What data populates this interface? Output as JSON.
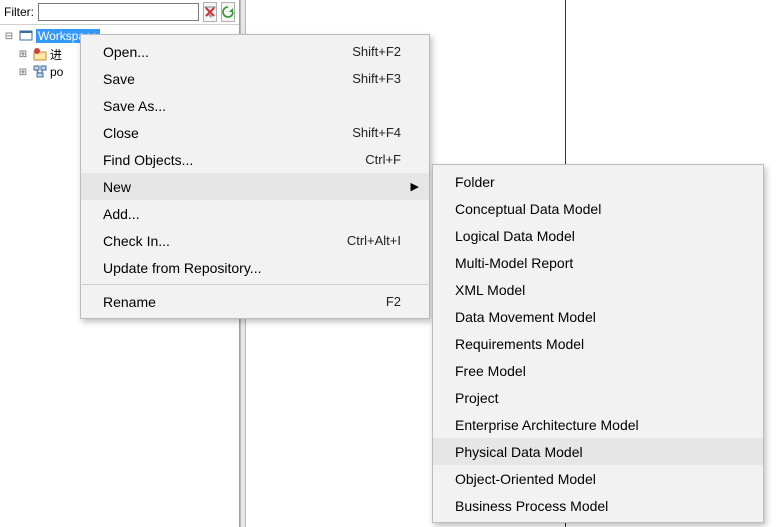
{
  "filter": {
    "label": "Filter:",
    "value": ""
  },
  "toolbar": {
    "remove_filter_tooltip": "Remove Filter",
    "refresh_tooltip": "Refresh"
  },
  "tree": {
    "items": [
      {
        "label": "Workspace",
        "selected": true
      },
      {
        "label": "进"
      },
      {
        "label": "po"
      }
    ]
  },
  "context_menu": {
    "items": [
      {
        "label": "Open...",
        "shortcut": "Shift+F2"
      },
      {
        "label": "Save",
        "shortcut": "Shift+F3"
      },
      {
        "label": "Save As..."
      },
      {
        "label": "Close",
        "shortcut": "Shift+F4"
      },
      {
        "label": "Find Objects...",
        "shortcut": "Ctrl+F"
      },
      {
        "label": "New",
        "submenu": true,
        "highlighted": true
      },
      {
        "label": "Add..."
      },
      {
        "label": "Check In...",
        "shortcut": "Ctrl+Alt+I"
      },
      {
        "label": "Update from Repository..."
      },
      {
        "sep": true
      },
      {
        "label": "Rename",
        "shortcut": "F2"
      }
    ]
  },
  "submenu_new": {
    "items": [
      {
        "label": "Folder"
      },
      {
        "label": "Conceptual Data Model"
      },
      {
        "label": "Logical Data Model"
      },
      {
        "label": "Multi-Model Report"
      },
      {
        "label": "XML Model"
      },
      {
        "label": "Data Movement Model"
      },
      {
        "label": "Requirements Model"
      },
      {
        "label": "Free Model"
      },
      {
        "label": "Project"
      },
      {
        "label": "Enterprise Architecture Model"
      },
      {
        "label": "Physical Data Model",
        "highlighted": true
      },
      {
        "label": "Object-Oriented Model"
      },
      {
        "label": "Business Process Model"
      }
    ]
  }
}
